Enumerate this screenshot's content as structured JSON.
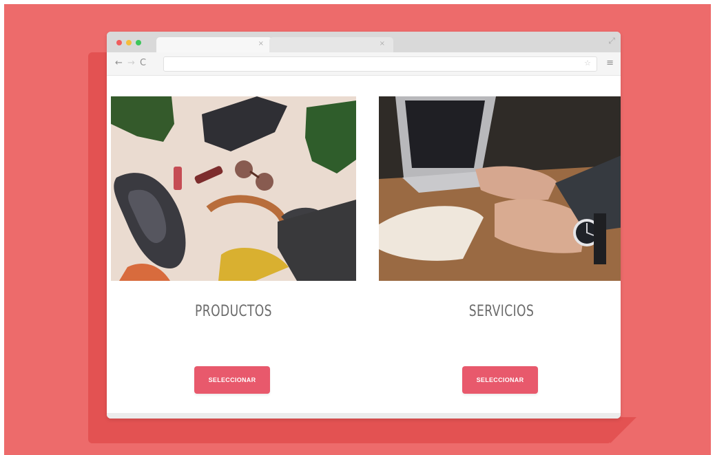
{
  "colors": {
    "background": "#ed6b6b",
    "button": "#e8596c",
    "title_text": "#6b6b6b"
  },
  "browser": {
    "traffic_lights": [
      "red-dot",
      "yellow-dot",
      "green-dot"
    ],
    "tabs": [
      {
        "close_icon": "×"
      },
      {
        "close_icon": "×"
      }
    ],
    "nav": {
      "back_icon": "←",
      "forward_icon": "→",
      "refresh_icon": "C"
    },
    "menu_icon": "≡",
    "expand_icon": "⤢",
    "star_icon": "☆"
  },
  "cards": [
    {
      "title": "PRODUCTOS",
      "button_label": "SELECCIONAR",
      "image": "flat-lay-products-photo"
    },
    {
      "title": "SERVICIOS",
      "button_label": "SELECCIONAR",
      "image": "person-writing-notes-laptop-photo"
    }
  ]
}
